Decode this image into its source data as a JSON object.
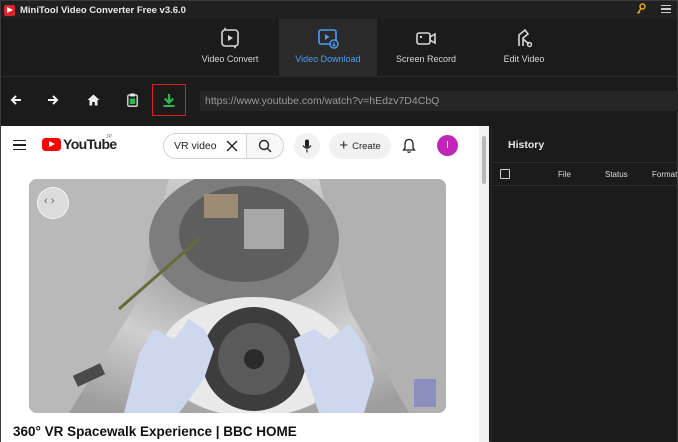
{
  "window": {
    "title": "MiniTool Video Converter Free v3.6.0"
  },
  "tabs": [
    {
      "label": "Video Convert",
      "icon": "convert-icon"
    },
    {
      "label": "Video Download",
      "icon": "download-screen-icon",
      "active": true
    },
    {
      "label": "Screen Record",
      "icon": "camera-icon"
    },
    {
      "label": "Edit Video",
      "icon": "scissors-icon"
    }
  ],
  "toolbar": {
    "url": "https://www.youtube.com/watch?v=hEdzv7D4CbQ",
    "icons": [
      "back-arrow-icon",
      "forward-arrow-icon",
      "home-icon",
      "clipboard-icon",
      "download-icon"
    ]
  },
  "youtube": {
    "logo_text": "YouTube",
    "country": "JP",
    "search_value": "VR video",
    "create_label": "Create",
    "avatar_letter": "I",
    "video_title": "360° VR Spacewalk Experience | BBC HOME"
  },
  "history": {
    "title": "History",
    "columns": [
      "File",
      "Status",
      "Format"
    ]
  },
  "colors": {
    "accent": "#4a9ff5",
    "download_green": "#2db84a",
    "highlight_red": "#e0201f",
    "youtube_red": "#ff0000",
    "avatar": "#c226b8"
  }
}
